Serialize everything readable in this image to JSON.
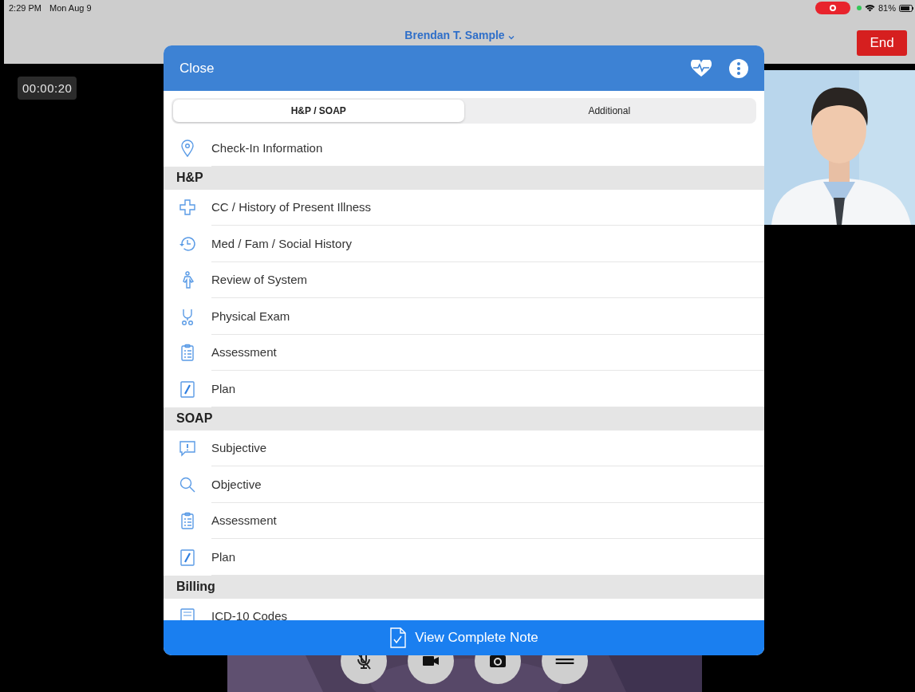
{
  "status_bar": {
    "time": "2:29 PM",
    "date": "Mon Aug 9",
    "battery": "81%",
    "recording": true
  },
  "call": {
    "caller": "Brendan T. Sample",
    "end_button": "End",
    "timer": "00:00:20"
  },
  "sheet": {
    "close": "Close",
    "tabs": [
      {
        "label": "H&P / SOAP",
        "selected": true
      },
      {
        "label": "Additional",
        "selected": false
      }
    ],
    "items": [
      {
        "kind": "row",
        "label": "Check-In Information"
      },
      {
        "kind": "header",
        "label": "H&P"
      },
      {
        "kind": "row",
        "label": "CC / History of Present Illness"
      },
      {
        "kind": "row",
        "label": "Med / Fam / Social History"
      },
      {
        "kind": "row",
        "label": "Review of System"
      },
      {
        "kind": "row",
        "label": "Physical Exam"
      },
      {
        "kind": "row",
        "label": "Assessment"
      },
      {
        "kind": "row",
        "label": "Plan"
      },
      {
        "kind": "header",
        "label": "SOAP"
      },
      {
        "kind": "row",
        "label": "Subjective"
      },
      {
        "kind": "row",
        "label": "Objective"
      },
      {
        "kind": "row",
        "label": "Assessment"
      },
      {
        "kind": "row",
        "label": "Plan"
      },
      {
        "kind": "header",
        "label": "Billing"
      },
      {
        "kind": "row",
        "label": "ICD-10 Codes"
      }
    ],
    "footer_button": "View Complete Note"
  }
}
